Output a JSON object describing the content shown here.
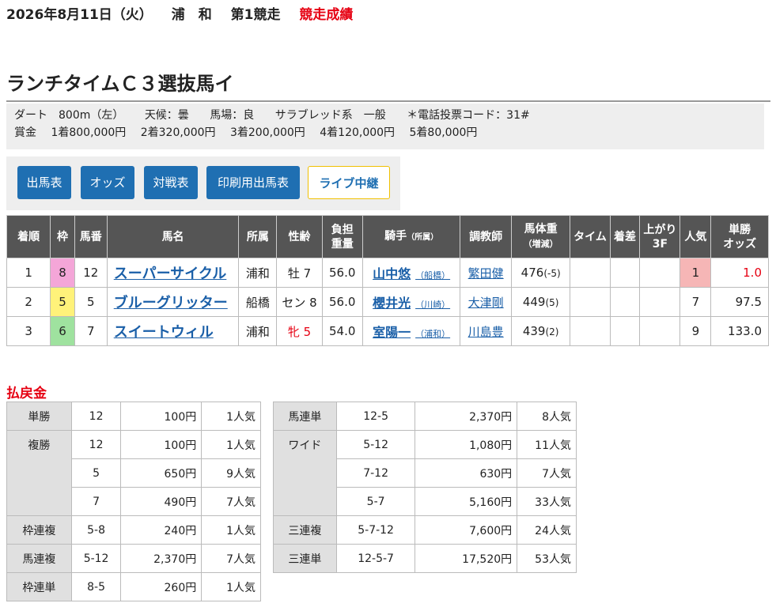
{
  "header": {
    "date": "2026年8月11日（火）",
    "venue": "浦　和",
    "race": "第1競走",
    "result": "競走成績"
  },
  "race_title": "ランチタイムＣ３選抜馬イ",
  "info": {
    "course": "ダート　800m（左）",
    "weather": "天候：曇",
    "track": "馬場：良",
    "breed": "サラブレッド系　一般",
    "phone_code": "＊電話投票コード：31#",
    "prize_label": "賞金",
    "prizes": [
      "1着800,000円",
      "2着320,000円",
      "3着200,000円",
      "4着120,000円",
      "5着80,000円"
    ]
  },
  "buttons": {
    "entries": "出馬表",
    "odds": "オッズ",
    "head_to_head": "対戦表",
    "print": "印刷用出馬表",
    "live": "ライブ中継"
  },
  "results": {
    "headers": {
      "rank": "着順",
      "frame": "枠",
      "num": "馬番",
      "horse": "馬名",
      "belong": "所属",
      "sexage": "性齢",
      "load1": "負担",
      "load2": "重量",
      "jockey": "騎手",
      "jockey_sub": "（所属）",
      "trainer": "調教師",
      "weight1": "馬体重",
      "weight2": "（増減）",
      "time": "タイム",
      "margin": "着差",
      "last1": "上がり",
      "last2": "3F",
      "pop": "人気",
      "odds1": "単勝",
      "odds2": "オッズ"
    },
    "rows": [
      {
        "rank": "1",
        "frame": "8",
        "num": "12",
        "horse": "スーパーサイクル",
        "belong": "浦和",
        "sexage": "牡 7",
        "load": "56.0",
        "jockey": "山中悠",
        "jaff": "（船橋）",
        "trainer": "繁田健",
        "weight": "476",
        "diff": "(-5)",
        "time": "",
        "margin": "",
        "last": "",
        "pop": "1",
        "odds": "1.0"
      },
      {
        "rank": "2",
        "frame": "5",
        "num": "5",
        "horse": "ブルーグリッター",
        "belong": "船橋",
        "sexage": "セン 8",
        "load": "56.0",
        "jockey": "櫻井光",
        "jaff": "（川崎）",
        "trainer": "大津剛",
        "weight": "449",
        "diff": "(5)",
        "time": "",
        "margin": "",
        "last": "",
        "pop": "7",
        "odds": "97.5"
      },
      {
        "rank": "3",
        "frame": "6",
        "num": "7",
        "horse": "スイートウィル",
        "belong": "浦和",
        "sexage": "牝 5",
        "load": "54.0",
        "jockey": "室陽一",
        "jaff": "（浦和）",
        "trainer": "川島豊",
        "weight": "439",
        "diff": "(2)",
        "time": "",
        "margin": "",
        "last": "",
        "pop": "9",
        "odds": "133.0"
      }
    ],
    "frame_colors": {
      "8": "#f4a6d8",
      "5": "#fff27a",
      "6": "#9fe29f"
    },
    "pop1_bg": "#f6b6b6"
  },
  "payout_title": "払戻金",
  "payouts_left": [
    {
      "kind": "単勝",
      "span": 1,
      "rows": [
        {
          "combo": "12",
          "amount": "100円",
          "pop": "1人気"
        }
      ]
    },
    {
      "kind": "複勝",
      "span": 3,
      "rows": [
        {
          "combo": "12",
          "amount": "100円",
          "pop": "1人気"
        },
        {
          "combo": "5",
          "amount": "650円",
          "pop": "9人気"
        },
        {
          "combo": "7",
          "amount": "490円",
          "pop": "7人気"
        }
      ]
    },
    {
      "kind": "枠連複",
      "span": 1,
      "rows": [
        {
          "combo": "5-8",
          "amount": "240円",
          "pop": "1人気"
        }
      ]
    },
    {
      "kind": "馬連複",
      "span": 1,
      "rows": [
        {
          "combo": "5-12",
          "amount": "2,370円",
          "pop": "7人気"
        }
      ]
    },
    {
      "kind": "枠連単",
      "span": 1,
      "rows": [
        {
          "combo": "8-5",
          "amount": "260円",
          "pop": "1人気"
        }
      ]
    }
  ],
  "payouts_right": [
    {
      "kind": "馬連単",
      "span": 1,
      "rows": [
        {
          "combo": "12-5",
          "amount": "2,370円",
          "pop": "8人気"
        }
      ]
    },
    {
      "kind": "ワイド",
      "span": 3,
      "rows": [
        {
          "combo": "5-12",
          "amount": "1,080円",
          "pop": "11人気"
        },
        {
          "combo": "7-12",
          "amount": "630円",
          "pop": "7人気"
        },
        {
          "combo": "5-7",
          "amount": "5,160円",
          "pop": "33人気"
        }
      ]
    },
    {
      "kind": "三連複",
      "span": 1,
      "rows": [
        {
          "combo": "5-7-12",
          "amount": "7,600円",
          "pop": "24人気"
        }
      ]
    },
    {
      "kind": "三連単",
      "span": 1,
      "rows": [
        {
          "combo": "12-5-7",
          "amount": "17,520円",
          "pop": "53人気"
        }
      ]
    }
  ]
}
